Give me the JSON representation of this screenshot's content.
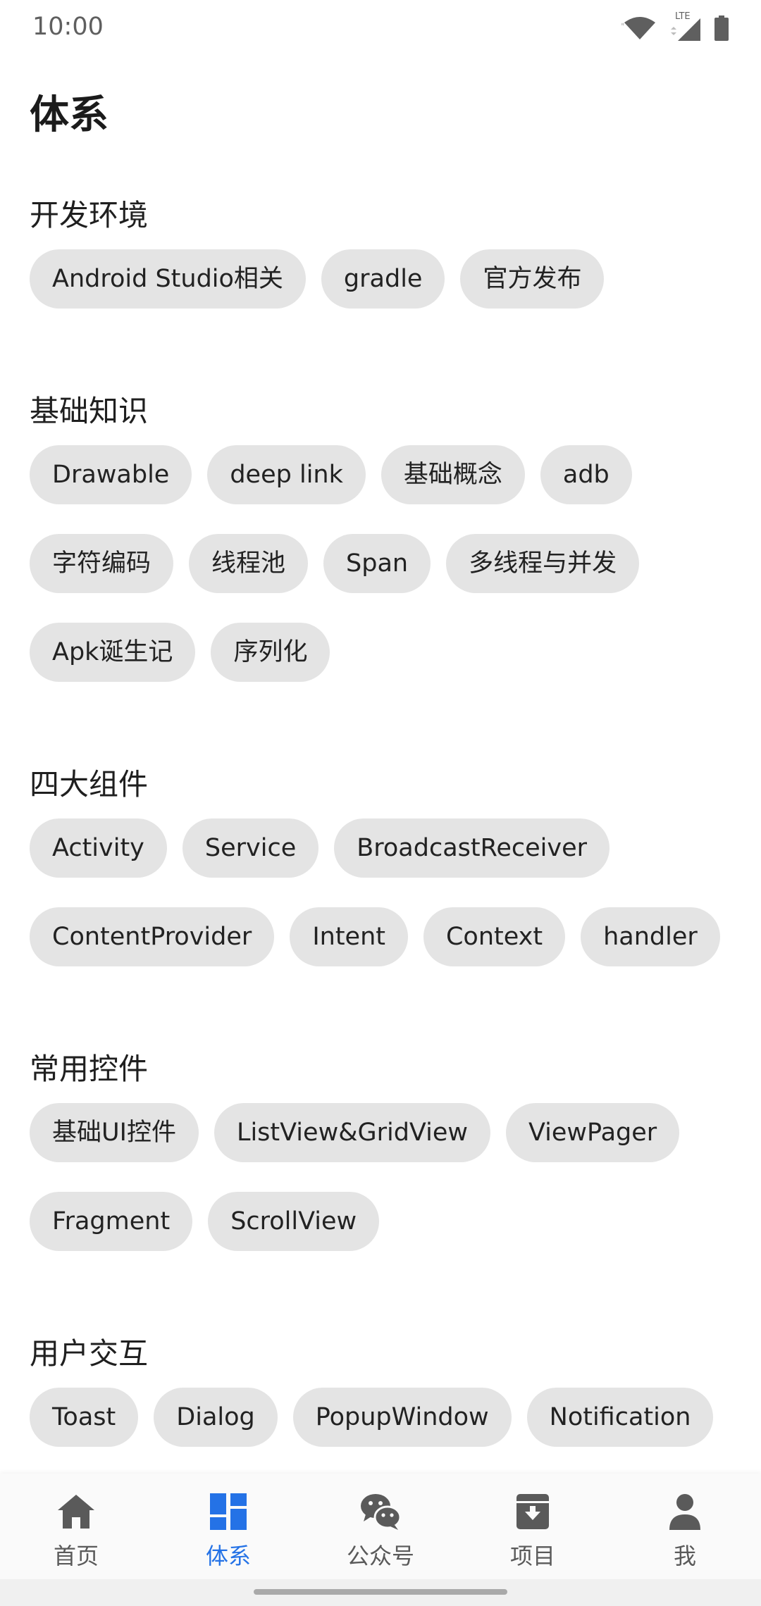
{
  "status_bar": {
    "time": "10:00",
    "network": "LTE"
  },
  "page_title": "体系",
  "sections": [
    {
      "title": "开发环境",
      "chips": [
        "Android Studio相关",
        "gradle",
        "官方发布"
      ]
    },
    {
      "title": "基础知识",
      "chips": [
        "Drawable",
        "deep link",
        "基础概念",
        "adb",
        "字符编码",
        "线程池",
        "Span",
        "多线程与并发",
        "Apk诞生记",
        "序列化"
      ]
    },
    {
      "title": "四大组件",
      "chips": [
        "Activity",
        "Service",
        "BroadcastReceiver",
        "ContentProvider",
        "Intent",
        "Context",
        "handler"
      ]
    },
    {
      "title": "常用控件",
      "chips": [
        "基础UI控件",
        "ListView&GridView",
        "ViewPager",
        "Fragment",
        "ScrollView"
      ]
    },
    {
      "title": "用户交互",
      "chips": [
        "Toast",
        "Dialog",
        "PopupWindow",
        "Notification"
      ]
    }
  ],
  "bottom_nav": {
    "active_index": 1,
    "items": [
      {
        "label": "首页",
        "icon": "home-icon"
      },
      {
        "label": "体系",
        "icon": "dashboard-icon"
      },
      {
        "label": "公众号",
        "icon": "wechat-icon"
      },
      {
        "label": "项目",
        "icon": "archive-icon"
      },
      {
        "label": "我",
        "icon": "person-icon"
      }
    ]
  },
  "colors": {
    "accent": "#2472e6",
    "chip_bg": "#e4e4e4",
    "inactive": "#5a5a5a"
  }
}
